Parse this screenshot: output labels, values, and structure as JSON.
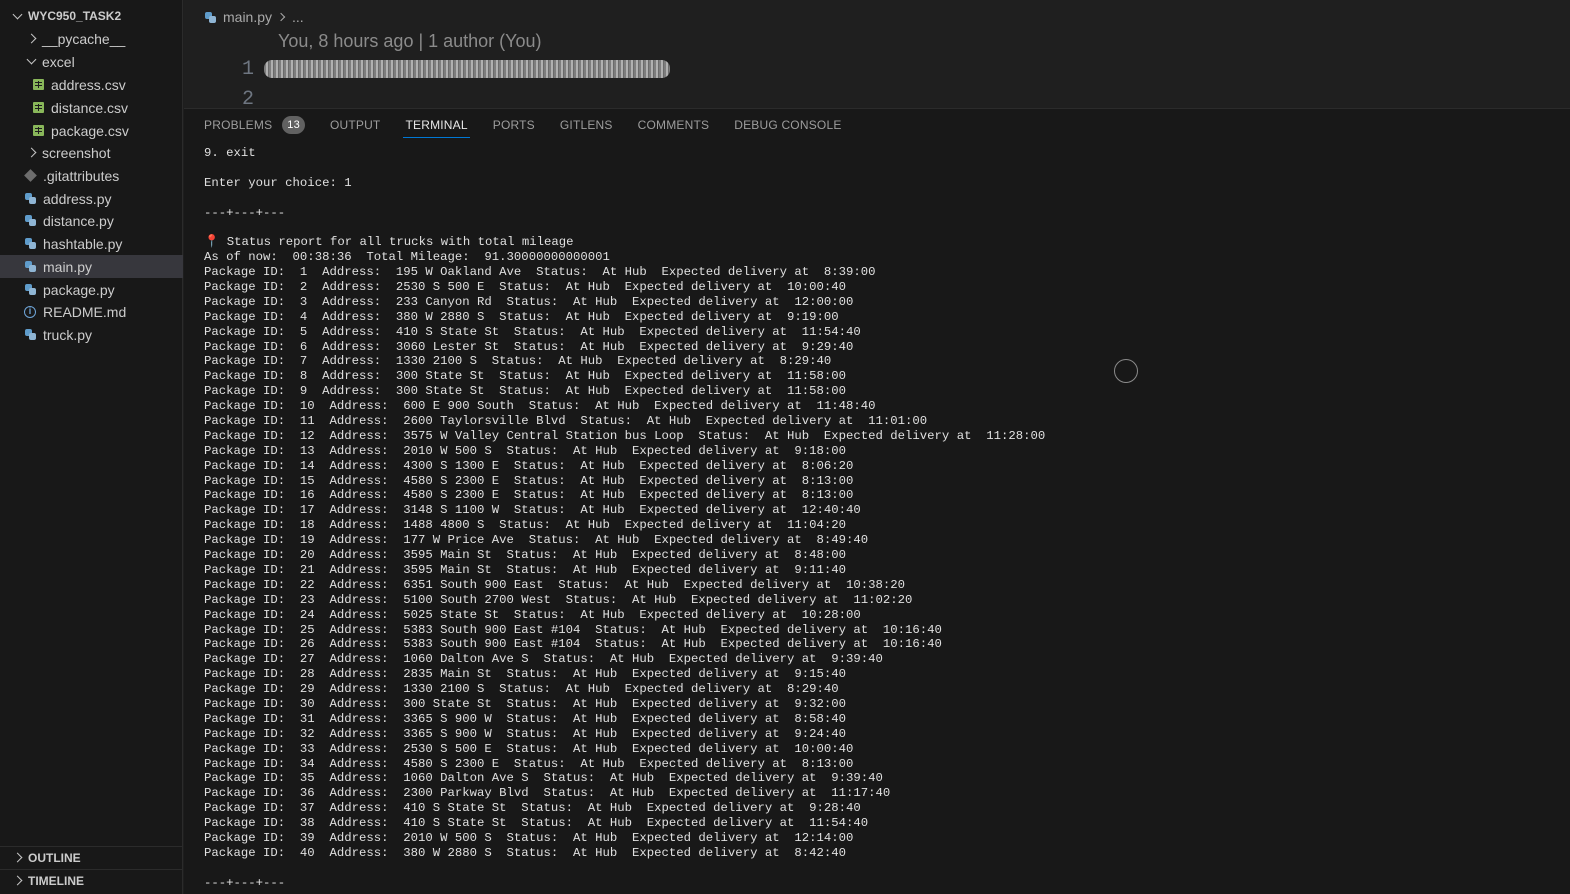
{
  "explorer": {
    "root_label": "WYC950_TASK2",
    "items": [
      {
        "label": "__pycache__",
        "kind": "folder-collapsed"
      },
      {
        "label": "excel",
        "kind": "folder-expanded"
      },
      {
        "label": "address.csv",
        "kind": "csv"
      },
      {
        "label": "distance.csv",
        "kind": "csv"
      },
      {
        "label": "package.csv",
        "kind": "csv"
      },
      {
        "label": "screenshot",
        "kind": "folder-collapsed"
      },
      {
        "label": ".gitattributes",
        "kind": "git"
      },
      {
        "label": "address.py",
        "kind": "python"
      },
      {
        "label": "distance.py",
        "kind": "python"
      },
      {
        "label": "hashtable.py",
        "kind": "python"
      },
      {
        "label": "main.py",
        "kind": "python",
        "selected": true
      },
      {
        "label": "package.py",
        "kind": "python"
      },
      {
        "label": "README.md",
        "kind": "info"
      },
      {
        "label": "truck.py",
        "kind": "python"
      }
    ],
    "outline_label": "OUTLINE",
    "timeline_label": "TIMELINE"
  },
  "editor": {
    "breadcrumb_file": "main.py",
    "breadcrumb_more": "...",
    "blame": "You, 8 hours ago | 1 author (You)",
    "line_1": "1",
    "line_2": "2"
  },
  "panel": {
    "tabs": [
      {
        "label": "PROBLEMS",
        "badge": "13"
      },
      {
        "label": "OUTPUT"
      },
      {
        "label": "TERMINAL",
        "active": true
      },
      {
        "label": "PORTS"
      },
      {
        "label": "GITLENS"
      },
      {
        "label": "COMMENTS"
      },
      {
        "label": "DEBUG CONSOLE"
      }
    ]
  },
  "terminal": {
    "pin_glyph": "📍",
    "lines": [
      "9. exit",
      "",
      "Enter your choice: 1",
      "",
      "---+---+---",
      "",
      "Status report for all trucks with total mileage",
      "As of now:  00:38:36  Total Mileage:  91.30000000000001",
      "Package ID:  1  Address:  195 W Oakland Ave  Status:  At Hub  Expected delivery at  8:39:00",
      "Package ID:  2  Address:  2530 S 500 E  Status:  At Hub  Expected delivery at  10:00:40",
      "Package ID:  3  Address:  233 Canyon Rd  Status:  At Hub  Expected delivery at  12:00:00",
      "Package ID:  4  Address:  380 W 2880 S  Status:  At Hub  Expected delivery at  9:19:00",
      "Package ID:  5  Address:  410 S State St  Status:  At Hub  Expected delivery at  11:54:40",
      "Package ID:  6  Address:  3060 Lester St  Status:  At Hub  Expected delivery at  9:29:40",
      "Package ID:  7  Address:  1330 2100 S  Status:  At Hub  Expected delivery at  8:29:40",
      "Package ID:  8  Address:  300 State St  Status:  At Hub  Expected delivery at  11:58:00",
      "Package ID:  9  Address:  300 State St  Status:  At Hub  Expected delivery at  11:58:00",
      "Package ID:  10  Address:  600 E 900 South  Status:  At Hub  Expected delivery at  11:48:40",
      "Package ID:  11  Address:  2600 Taylorsville Blvd  Status:  At Hub  Expected delivery at  11:01:00",
      "Package ID:  12  Address:  3575 W Valley Central Station bus Loop  Status:  At Hub  Expected delivery at  11:28:00",
      "Package ID:  13  Address:  2010 W 500 S  Status:  At Hub  Expected delivery at  9:18:00",
      "Package ID:  14  Address:  4300 S 1300 E  Status:  At Hub  Expected delivery at  8:06:20",
      "Package ID:  15  Address:  4580 S 2300 E  Status:  At Hub  Expected delivery at  8:13:00",
      "Package ID:  16  Address:  4580 S 2300 E  Status:  At Hub  Expected delivery at  8:13:00",
      "Package ID:  17  Address:  3148 S 1100 W  Status:  At Hub  Expected delivery at  12:40:40",
      "Package ID:  18  Address:  1488 4800 S  Status:  At Hub  Expected delivery at  11:04:20",
      "Package ID:  19  Address:  177 W Price Ave  Status:  At Hub  Expected delivery at  8:49:40",
      "Package ID:  20  Address:  3595 Main St  Status:  At Hub  Expected delivery at  8:48:00",
      "Package ID:  21  Address:  3595 Main St  Status:  At Hub  Expected delivery at  9:11:40",
      "Package ID:  22  Address:  6351 South 900 East  Status:  At Hub  Expected delivery at  10:38:20",
      "Package ID:  23  Address:  5100 South 2700 West  Status:  At Hub  Expected delivery at  11:02:20",
      "Package ID:  24  Address:  5025 State St  Status:  At Hub  Expected delivery at  10:28:00",
      "Package ID:  25  Address:  5383 South 900 East #104  Status:  At Hub  Expected delivery at  10:16:40",
      "Package ID:  26  Address:  5383 South 900 East #104  Status:  At Hub  Expected delivery at  10:16:40",
      "Package ID:  27  Address:  1060 Dalton Ave S  Status:  At Hub  Expected delivery at  9:39:40",
      "Package ID:  28  Address:  2835 Main St  Status:  At Hub  Expected delivery at  9:15:40",
      "Package ID:  29  Address:  1330 2100 S  Status:  At Hub  Expected delivery at  8:29:40",
      "Package ID:  30  Address:  300 State St  Status:  At Hub  Expected delivery at  9:32:00",
      "Package ID:  31  Address:  3365 S 900 W  Status:  At Hub  Expected delivery at  8:58:40",
      "Package ID:  32  Address:  3365 S 900 W  Status:  At Hub  Expected delivery at  9:24:40",
      "Package ID:  33  Address:  2530 S 500 E  Status:  At Hub  Expected delivery at  10:00:40",
      "Package ID:  34  Address:  4580 S 2300 E  Status:  At Hub  Expected delivery at  8:13:00",
      "Package ID:  35  Address:  1060 Dalton Ave S  Status:  At Hub  Expected delivery at  9:39:40",
      "Package ID:  36  Address:  2300 Parkway Blvd  Status:  At Hub  Expected delivery at  11:17:40",
      "Package ID:  37  Address:  410 S State St  Status:  At Hub  Expected delivery at  9:28:40",
      "Package ID:  38  Address:  410 S State St  Status:  At Hub  Expected delivery at  11:54:40",
      "Package ID:  39  Address:  2010 W 500 S  Status:  At Hub  Expected delivery at  12:14:00",
      "Package ID:  40  Address:  380 W 2880 S  Status:  At Hub  Expected delivery at  8:42:40",
      "",
      "---+---+---"
    ]
  }
}
